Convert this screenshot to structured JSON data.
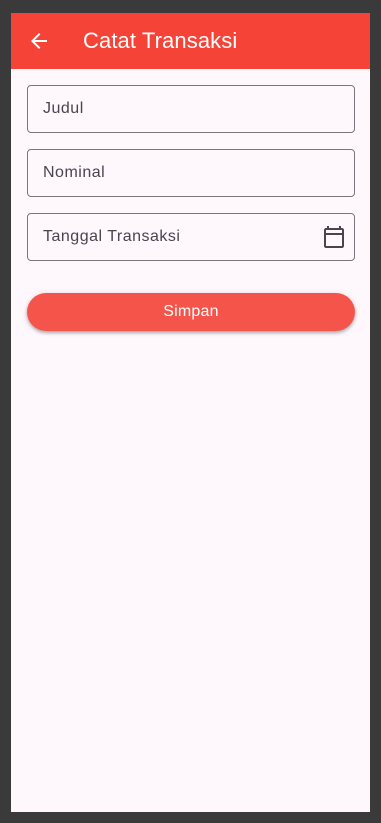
{
  "appbar": {
    "title": "Catat Transaksi",
    "back_icon": "arrow-back-icon",
    "color": "#f54437"
  },
  "form": {
    "judul": {
      "placeholder": "Judul",
      "value": ""
    },
    "nominal": {
      "placeholder": "Nominal",
      "value": ""
    },
    "tanggal": {
      "placeholder": "Tanggal Transaksi",
      "value": "",
      "icon": "calendar-icon"
    },
    "submit_label": "Simpan",
    "submit_color": "#f5544a"
  },
  "colors": {
    "background": "#fef7fc",
    "frame": "#3a3a3a"
  }
}
